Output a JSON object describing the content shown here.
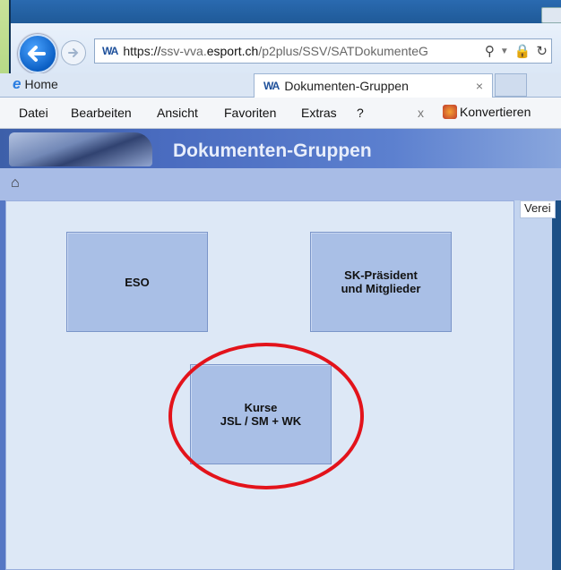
{
  "browser": {
    "site_badge": "WA",
    "url": {
      "scheme": "https://",
      "prefix": "ssv-vva.",
      "host": "esport.ch",
      "path": "/p2plus/SSV/SATDokumenteG"
    },
    "tabs": [
      {
        "label": "Home"
      },
      {
        "label": "Dokumenten-Gruppen",
        "close": "×"
      }
    ],
    "menu": [
      "Datei",
      "Bearbeiten",
      "Ansicht",
      "Favoriten",
      "Extras",
      "?"
    ],
    "menu_close": "x",
    "toolbar_extra": "Konvertieren"
  },
  "page": {
    "title": "Dokumenten-Gruppen",
    "right_tab": "Verei",
    "tiles": [
      {
        "line1": "ESO"
      },
      {
        "line1": "SK-Präsident",
        "line2": "und Mitglieder"
      },
      {
        "line1": "Kurse",
        "line2": "JSL / SM + WK"
      }
    ],
    "highlight_color": "#e3131b"
  }
}
